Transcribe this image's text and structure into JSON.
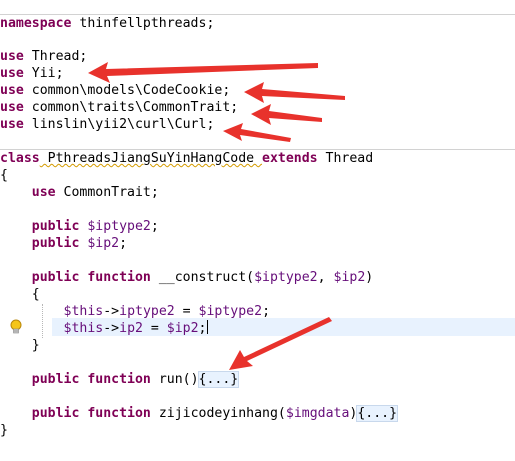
{
  "editor": {
    "lines": [
      [
        {
          "t": "namespace",
          "c": "kw"
        },
        {
          "t": " thinfellpthreads;",
          "c": ""
        }
      ],
      [
        {
          "t": "use",
          "c": "kw"
        },
        {
          "t": " Thread;",
          "c": ""
        }
      ],
      [
        {
          "t": "use",
          "c": "kw"
        },
        {
          "t": " Yii;",
          "c": ""
        }
      ],
      [
        {
          "t": "use",
          "c": "kw"
        },
        {
          "t": " common\\models\\CodeCookie;",
          "c": ""
        }
      ],
      [
        {
          "t": "use",
          "c": "kw"
        },
        {
          "t": " common\\traits\\CommonTrait;",
          "c": ""
        }
      ],
      [
        {
          "t": "use",
          "c": "kw"
        },
        {
          "t": " linslin\\yii2\\curl\\Curl;",
          "c": ""
        }
      ],
      [
        {
          "t": "class",
          "c": "kw"
        },
        {
          "t": " PthreadsJiangSuYinHangCode ",
          "c": ""
        },
        {
          "t": "extends",
          "c": "kw"
        },
        {
          "t": " Thread",
          "c": ""
        }
      ],
      [
        {
          "t": "{",
          "c": ""
        }
      ],
      [
        {
          "t": "    ",
          "c": ""
        },
        {
          "t": "use",
          "c": "kw"
        },
        {
          "t": " CommonTrait;",
          "c": ""
        }
      ],
      [
        {
          "t": "    ",
          "c": ""
        },
        {
          "t": "public",
          "c": "kw"
        },
        {
          "t": " ",
          "c": ""
        },
        {
          "t": "$iptype2",
          "c": "var"
        },
        {
          "t": ";",
          "c": ""
        }
      ],
      [
        {
          "t": "    ",
          "c": ""
        },
        {
          "t": "public",
          "c": "kw"
        },
        {
          "t": " ",
          "c": ""
        },
        {
          "t": "$ip2",
          "c": "var"
        },
        {
          "t": ";",
          "c": ""
        }
      ],
      [
        {
          "t": "    ",
          "c": ""
        },
        {
          "t": "public",
          "c": "kw"
        },
        {
          "t": " ",
          "c": ""
        },
        {
          "t": "function",
          "c": "kw"
        },
        {
          "t": " __construct(",
          "c": ""
        },
        {
          "t": "$iptype2",
          "c": "var"
        },
        {
          "t": ", ",
          "c": ""
        },
        {
          "t": "$ip2",
          "c": "var"
        },
        {
          "t": ")",
          "c": ""
        }
      ],
      [
        {
          "t": "    {",
          "c": ""
        }
      ],
      [
        {
          "t": "        ",
          "c": ""
        },
        {
          "t": "$this",
          "c": "var"
        },
        {
          "t": "->",
          "c": ""
        },
        {
          "t": "iptype2",
          "c": "var"
        },
        {
          "t": " = ",
          "c": ""
        },
        {
          "t": "$iptype2",
          "c": "var"
        },
        {
          "t": ";",
          "c": ""
        }
      ],
      [
        {
          "t": "        ",
          "c": ""
        },
        {
          "t": "$this",
          "c": "var"
        },
        {
          "t": "->",
          "c": ""
        },
        {
          "t": "ip2",
          "c": "var"
        },
        {
          "t": " = ",
          "c": ""
        },
        {
          "t": "$ip2",
          "c": "var"
        },
        {
          "t": ";",
          "c": ""
        }
      ],
      [
        {
          "t": "    }",
          "c": ""
        }
      ],
      [
        {
          "t": "    ",
          "c": ""
        },
        {
          "t": "public",
          "c": "kw"
        },
        {
          "t": " ",
          "c": ""
        },
        {
          "t": "function",
          "c": "kw"
        },
        {
          "t": " run()",
          "c": ""
        },
        {
          "t": "{...}",
          "c": "fold"
        }
      ],
      [
        {
          "t": "    ",
          "c": ""
        },
        {
          "t": "public",
          "c": "kw"
        },
        {
          "t": " ",
          "c": ""
        },
        {
          "t": "function",
          "c": "kw"
        },
        {
          "t": " zijicodeyinhang(",
          "c": ""
        },
        {
          "t": "$imgdata",
          "c": "var"
        },
        {
          "t": ")",
          "c": ""
        },
        {
          "t": "{...}",
          "c": "fold"
        }
      ],
      [
        {
          "t": "}",
          "c": ""
        }
      ]
    ],
    "bulb_icon": "lightbulb-icon",
    "annotation_color": "#e8322c"
  }
}
